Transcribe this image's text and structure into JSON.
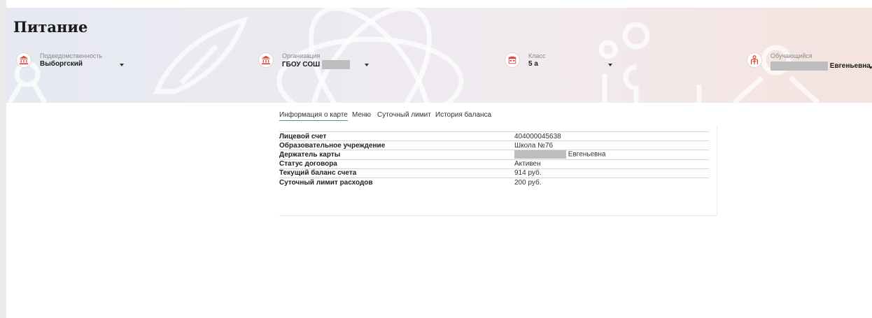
{
  "page": {
    "title": "Питание"
  },
  "selectors": [
    {
      "label": "Подведомственность",
      "value": "Выборгский",
      "icon": "institution-icon"
    },
    {
      "label": "Организация",
      "value": "ГБОУ СОШ",
      "icon": "institution-icon"
    },
    {
      "label": "Класс",
      "value": "5 а",
      "icon": "class-icon"
    },
    {
      "label": "Обучающийся",
      "value": "Евгеньевна",
      "icon": "student-icon"
    }
  ],
  "tabs": [
    {
      "label": "Информация о карте",
      "active": true
    },
    {
      "label": "Меню",
      "active": false
    },
    {
      "label": "Суточный лимит",
      "active": false
    },
    {
      "label": "История баланса",
      "active": false
    }
  ],
  "card_info": {
    "rows": [
      {
        "key": "Лицевой счет",
        "value": "404000045638"
      },
      {
        "key": "Образовательное учреждение",
        "value": "Школа №76"
      },
      {
        "key": "Держатель карты",
        "value": "Евгеньевна"
      },
      {
        "key": "Статус договора",
        "value": "Активен"
      },
      {
        "key": "Текущий баланс счета",
        "value": "914 руб."
      },
      {
        "key": "Суточный лимит расходов",
        "value": "200 руб."
      }
    ]
  },
  "colors": {
    "accent": "#3a9d6d",
    "icon": "#d9453b"
  }
}
